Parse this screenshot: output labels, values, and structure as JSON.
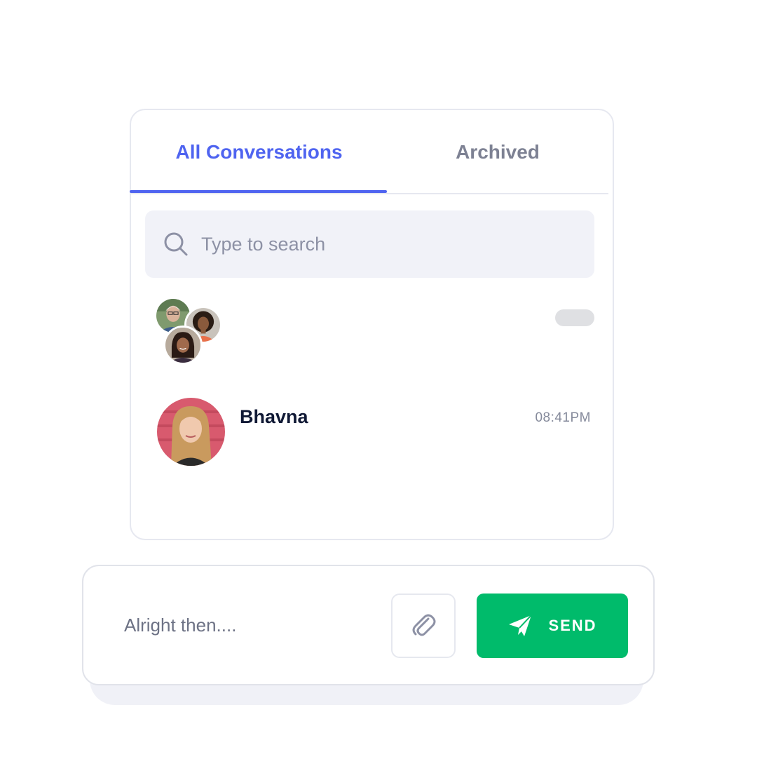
{
  "tabs": [
    {
      "label": "All Conversations",
      "active": true
    },
    {
      "label": "Archived",
      "active": false
    }
  ],
  "search": {
    "placeholder": "Type to search",
    "icon": "search-icon"
  },
  "conversations": [
    {
      "type": "group",
      "name": "",
      "time": "",
      "avatars": [
        "avatar-older-man",
        "avatar-woman-curly",
        "avatar-woman-smiling"
      ]
    },
    {
      "type": "direct",
      "name": "Bhavna",
      "time": "08:41PM",
      "avatar": "avatar-bhavna"
    }
  ],
  "composer": {
    "message_value": "Alright then....",
    "attach_icon": "paperclip-icon",
    "send_icon": "paper-plane-icon",
    "send_label": "SEND"
  },
  "colors": {
    "accent": "#4f64f0",
    "send": "#00bb6b",
    "tab_inactive": "#7d8193",
    "search_bg": "#f1f2f8"
  }
}
